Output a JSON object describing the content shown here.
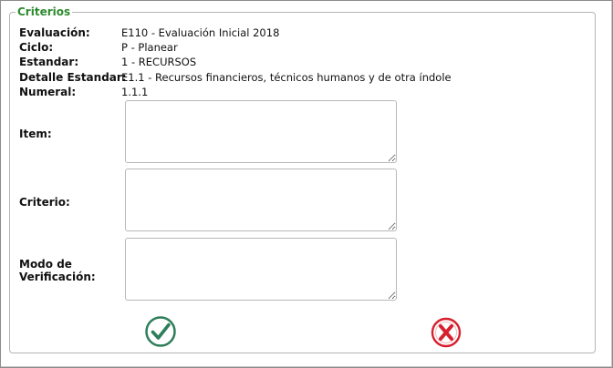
{
  "section": {
    "legend": "Criterios"
  },
  "info": [
    {
      "label": "Evaluación:",
      "value": "E110 - Evaluación Inicial 2018"
    },
    {
      "label": "Ciclo:",
      "value": "P - Planear"
    },
    {
      "label": "Estandar:",
      "value": "1 - RECURSOS"
    },
    {
      "label": "Detalle Estandar:",
      "value": "E1.1 - Recursos financieros, técnicos humanos y de otra índole"
    },
    {
      "label": "Numeral:",
      "value": "1.1.1"
    }
  ],
  "fields": {
    "item_label": "Item:",
    "item_value": "",
    "criterio_label": "Criterio:",
    "criterio_value": "",
    "modo_label": "Modo de Verificación:",
    "modo_value": ""
  },
  "actions": {
    "accept_icon": "check-circle-icon",
    "accept_color": "#2e7d5b",
    "cancel_icon": "x-circle-icon",
    "cancel_color": "#d6202e"
  }
}
